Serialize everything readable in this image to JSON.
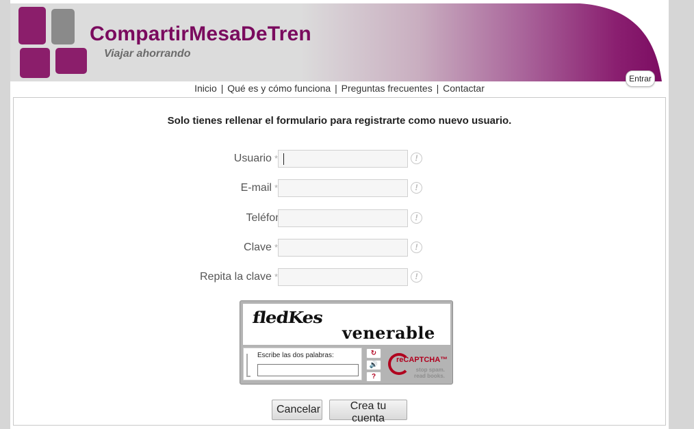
{
  "header": {
    "title": "CompartirMesaDeTren",
    "tagline": "Viajar ahorrando",
    "login_label": "Entrar"
  },
  "nav": {
    "items": [
      "Inicio",
      "Qué es y cómo funciona",
      "Preguntas frecuentes",
      "Contactar"
    ],
    "separator": "|"
  },
  "form": {
    "intro": "Solo tienes rellenar el formulario para registrarte como nuevo usuario.",
    "required_mark": "*",
    "hint_glyph": "!",
    "fields": [
      {
        "label": "Usuario",
        "required": true,
        "value": ""
      },
      {
        "label": "E-mail",
        "required": true,
        "value": ""
      },
      {
        "label": "Teléfono",
        "required": false,
        "value": ""
      },
      {
        "label": "Clave",
        "required": true,
        "value": ""
      },
      {
        "label": "Repita la clave",
        "required": true,
        "value": ""
      }
    ]
  },
  "captcha": {
    "word1": "fledKes",
    "word2": "venerable",
    "prompt": "Escribe las dos palabras:",
    "input_value": "",
    "brand": "reCAPTCHA™",
    "slogan_line1": "stop spam.",
    "slogan_line2": "read books.",
    "icons": [
      "refresh-icon",
      "audio-icon",
      "help-icon"
    ]
  },
  "actions": {
    "cancel_label": "Cancelar",
    "create_label": "Crea tu cuenta"
  },
  "colors": {
    "brand": "#7a0a5e",
    "logo_purple": "#8b1e6b",
    "logo_gray": "#8a8a8a",
    "recaptcha_red": "#b0001e"
  }
}
